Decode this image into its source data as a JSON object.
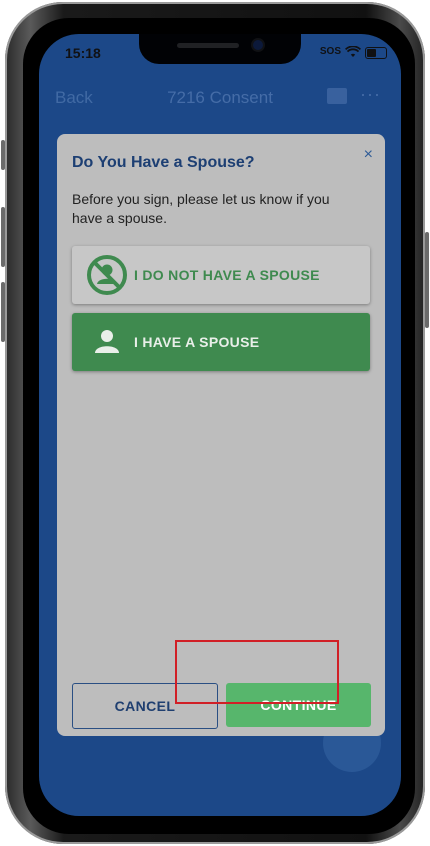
{
  "status_bar": {
    "time": "15:18",
    "carrier": "SOS"
  },
  "nav": {
    "back_label": "Back",
    "title": "7216 Consent",
    "more_label": "···"
  },
  "modal": {
    "title": "Do You Have a Spouse?",
    "close_label": "×",
    "description": "Before you sign, please let us know if you have a spouse.",
    "options": [
      {
        "label": "I DO NOT HAVE A SPOUSE",
        "icon": "no-person-icon"
      },
      {
        "label": "I HAVE A SPOUSE",
        "icon": "person-icon"
      }
    ],
    "cancel_label": "CANCEL",
    "continue_label": "CONTINUE"
  },
  "colors": {
    "accent_green": "#57b66c",
    "dark_green": "#3f8a4f",
    "app_blue": "#1e4d8f",
    "highlight_red": "#d11f26"
  }
}
